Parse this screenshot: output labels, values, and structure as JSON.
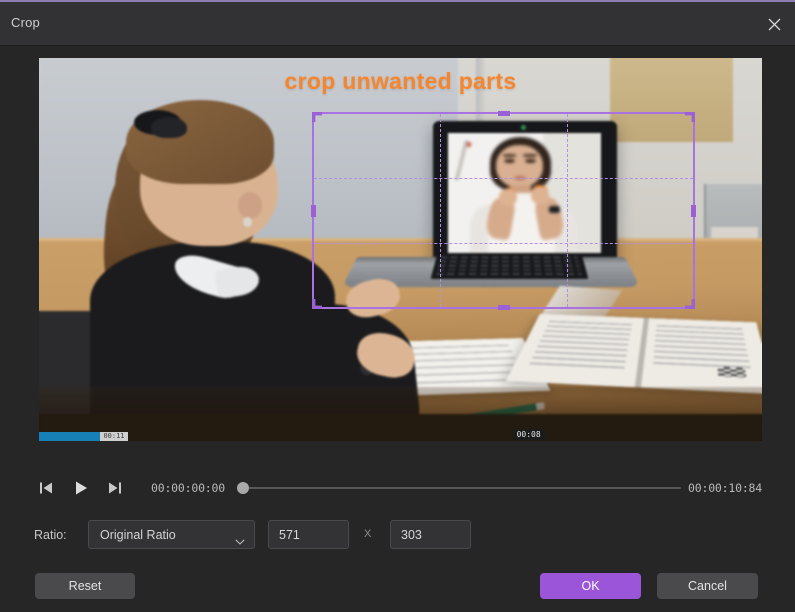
{
  "window": {
    "title": "Crop",
    "close_icon": "close-icon"
  },
  "preview": {
    "annotation_text": "crop unwanted parts",
    "annotation_color": "#f5862e",
    "video_timestamp_overlay": "00:08",
    "video_progress_label": "00:11"
  },
  "crop_overlay": {
    "accent_color": "#a872e0",
    "grid_color": "#b08fe6"
  },
  "transport": {
    "prev_frame_icon": "skip-to-start-icon",
    "play_icon": "play-icon",
    "next_frame_icon": "skip-to-end-icon",
    "current_time": "00:00:00:00",
    "total_time": "00:00:10:84"
  },
  "ratio": {
    "label": "Ratio:",
    "selected": "Original Ratio",
    "chevron_icon": "chevron-down-icon",
    "width_value": "571",
    "separator": "X",
    "height_value": "303"
  },
  "footer": {
    "reset_label": "Reset",
    "ok_label": "OK",
    "cancel_label": "Cancel",
    "ok_color": "#9a55d9"
  }
}
